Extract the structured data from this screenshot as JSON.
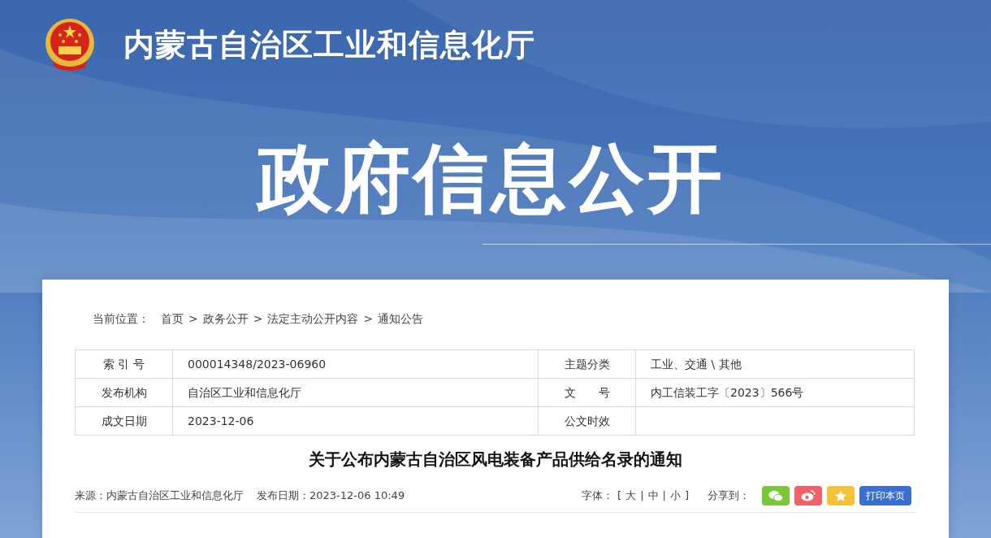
{
  "site": {
    "name": "内蒙古自治区工业和信息化厅"
  },
  "banner": {
    "title": "政府信息公开"
  },
  "breadcrumb": {
    "label": "当前位置：",
    "separator": ">",
    "items": [
      "首页",
      "政务公开",
      "法定主动公开内容",
      "通知公告"
    ]
  },
  "info_table": [
    [
      {
        "label": "索 引 号",
        "value": "000014348/2023-06960"
      },
      {
        "label": "主题分类",
        "value": "工业、交通 \\ 其他"
      }
    ],
    [
      {
        "label": "发布机构",
        "value": "自治区工业和信息化厅"
      },
      {
        "label": "文　　号",
        "value": "内工信装工字〔2023〕566号"
      }
    ],
    [
      {
        "label": "成文日期",
        "value": "2023-12-06"
      },
      {
        "label": "公文时效"
      }
    ]
  ],
  "article": {
    "title": "关于公布内蒙古自治区风电装备产品供给名录的通知",
    "source": "来源：内蒙古自治区工业和信息化厅",
    "date": "发布日期：2023-12-06 10:49"
  },
  "font_size": {
    "label": "字体：",
    "open": "[",
    "close": "]",
    "separator": "|",
    "options": [
      "大",
      "中",
      "小"
    ]
  },
  "share": {
    "label": "分享到：",
    "buttons": [
      {
        "kind": "wechat"
      },
      {
        "kind": "weibo"
      },
      {
        "kind": "qzone"
      },
      {
        "kind": "print",
        "label": "打印本页"
      }
    ]
  }
}
